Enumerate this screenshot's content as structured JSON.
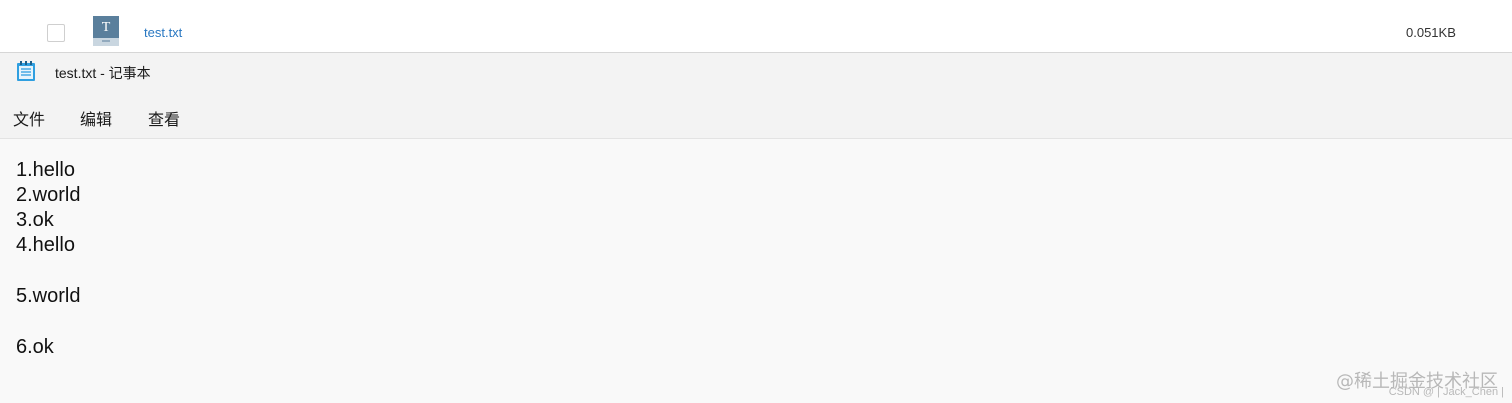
{
  "file_row": {
    "name": "test.txt",
    "size": "0.051KB",
    "icon": "text-file-icon"
  },
  "window": {
    "title": "test.txt - 记事本",
    "icon": "notepad-icon"
  },
  "menu": {
    "file": "文件",
    "edit": "编辑",
    "view": "查看"
  },
  "editor": {
    "lines": [
      "1.hello",
      "2.world",
      "3.ok",
      "4.hello",
      "",
      "5.world",
      "",
      "6.ok"
    ]
  },
  "watermark": {
    "primary": "@稀土掘金技术社区",
    "secondary": "CSDN @ | Jack_Chen |"
  },
  "colors": {
    "link": "#2a78c2",
    "background": "#f9f9f9",
    "chrome": "#f3f3f3"
  }
}
